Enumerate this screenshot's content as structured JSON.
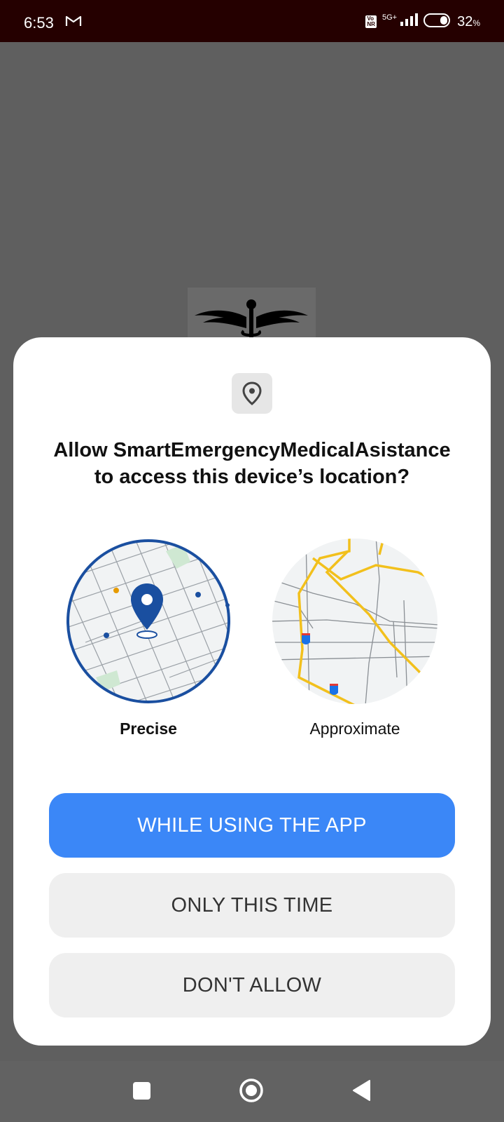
{
  "status_bar": {
    "time": "6:53",
    "network": "5G+",
    "battery": "32",
    "battery_unit": "%"
  },
  "icons": {
    "gmail": "gmail-icon",
    "location": "location-pin-icon",
    "app_logo": "caduceus-logo"
  },
  "dialog": {
    "title": "Allow SmartEmergencyMedicalAsistance to access this device’s location?",
    "options": {
      "precise_label": "Precise",
      "approximate_label": "Approximate",
      "selected": "Precise"
    },
    "buttons": {
      "while_using": "WHILE USING THE APP",
      "only_this_time": "ONLY THIS TIME",
      "dont_allow": "DON'T ALLOW"
    }
  },
  "colors": {
    "primary": "#3b87f7",
    "selected_ring": "#1a4fa0",
    "status_bar": "#250000",
    "road_yellow": "#f2c01c"
  }
}
